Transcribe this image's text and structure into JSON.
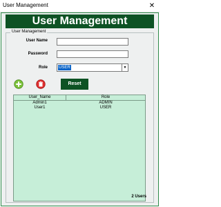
{
  "window": {
    "title": "User Management",
    "close_glyph": "✕"
  },
  "header": {
    "title": "User Management"
  },
  "form": {
    "group_label": "User Management",
    "username_label": "User Name",
    "username_value": "",
    "password_label": "Password",
    "password_value": "",
    "role_label": "Role",
    "role_value": "USER"
  },
  "toolbar": {
    "add_icon": "plus-circle-icon",
    "delete_icon": "trash-icon",
    "reset_label": "Reset"
  },
  "table": {
    "columns": [
      "User_Name",
      "Role"
    ],
    "rows": [
      [
        "Admin1",
        "ADMIN"
      ],
      [
        "User1",
        "USER"
      ]
    ]
  },
  "status": {
    "count_text": "2 Users"
  },
  "colors": {
    "header_bg": "#0d5224",
    "table_bg": "#c6eed8",
    "window_bg": "#eef0f0"
  }
}
